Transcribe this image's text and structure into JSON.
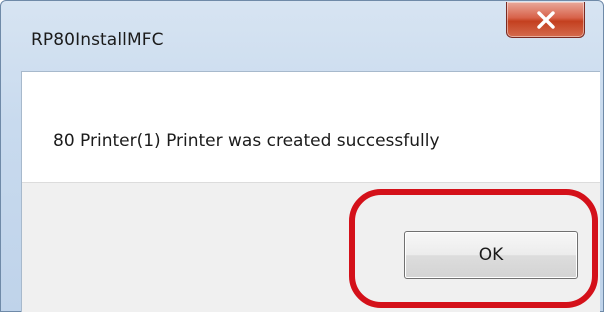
{
  "window": {
    "title": "RP80InstallMFC",
    "close_icon": "close-x-icon"
  },
  "dialog": {
    "message": "80 Printer(1) Printer was created successfully",
    "ok_label": "OK"
  },
  "colors": {
    "highlight": "#d4111a",
    "close_button": "#c4401f",
    "title_bar": "#c8daee"
  }
}
